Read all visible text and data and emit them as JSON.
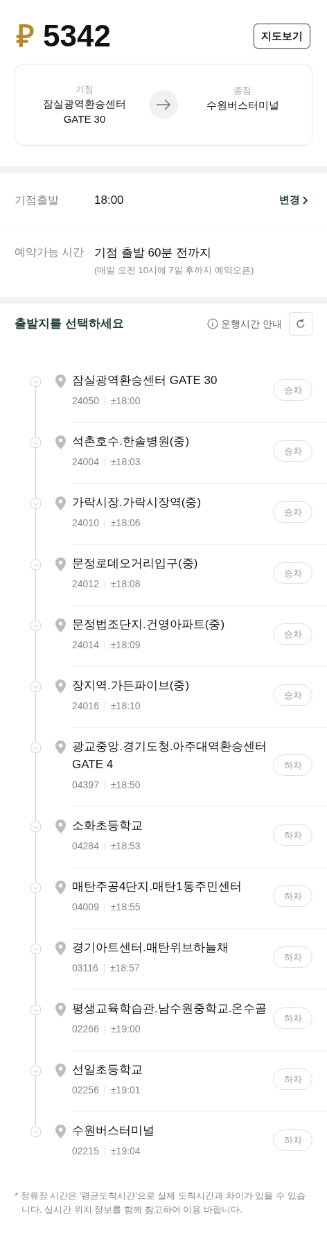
{
  "fare": {
    "symbol": "₽",
    "amount": "5342"
  },
  "map_button": "지도보기",
  "route": {
    "origin_label": "기점",
    "origin": "잠실광역환승센터\nGATE 30",
    "destination_label": "종점",
    "destination": "수원버스터미널"
  },
  "departure": {
    "label": "기점출발",
    "value": "18:00",
    "action": "변경"
  },
  "booking": {
    "label": "예약가능 시간",
    "value": "기점 출발 60분 전까지",
    "note": "(매일 오전 10시에 7일 후까지 예약오픈)"
  },
  "stops_header": {
    "title": "출발지를 선택하세요",
    "info": "운행시간 안내"
  },
  "stops": [
    {
      "name": "잠실광역환승센터 GATE 30",
      "code": "24050",
      "time": "±18:00",
      "action": "승차",
      "disabled": true
    },
    {
      "name": "석촌호수.한솔병원(중)",
      "code": "24004",
      "time": "±18:03",
      "action": "승차",
      "disabled": true
    },
    {
      "name": "가락시장.가락시장역(중)",
      "code": "24010",
      "time": "±18:06",
      "action": "승차",
      "disabled": true
    },
    {
      "name": "문정로데오거리입구(중)",
      "code": "24012",
      "time": "±18:08",
      "action": "승차",
      "disabled": true
    },
    {
      "name": "문정법조단지.건영아파트(중)",
      "code": "24014",
      "time": "±18:09",
      "action": "승차",
      "disabled": true
    },
    {
      "name": "장지역.가든파이브(중)",
      "code": "24016",
      "time": "±18:10",
      "action": "승차",
      "disabled": true
    },
    {
      "name": "광교중앙.경기도청.아주대역환승센터\nGATE 4",
      "code": "04397",
      "time": "±18:50",
      "action": "하차",
      "disabled": true
    },
    {
      "name": "소화초등학교",
      "code": "04284",
      "time": "±18:53",
      "action": "하차",
      "disabled": true
    },
    {
      "name": "매탄주공4단지.매탄1동주민센터",
      "code": "04009",
      "time": "±18:55",
      "action": "하차",
      "disabled": true
    },
    {
      "name": "경기아트센터.매탄위브하늘채",
      "code": "03116",
      "time": "±18:57",
      "action": "하차",
      "disabled": true
    },
    {
      "name": "평생교육학습관.남수원중학교.온수골",
      "code": "02266",
      "time": "±19:00",
      "action": "하차",
      "disabled": true
    },
    {
      "name": "선일초등학교",
      "code": "02256",
      "time": "±19:01",
      "action": "하차",
      "disabled": true
    },
    {
      "name": "수원버스터미널",
      "code": "02215",
      "time": "±19:04",
      "action": "하차",
      "disabled": true
    }
  ],
  "footnote": "* 정류장 시간은 '평균도착시간'으로 실제 도착시간과 차이가 있을 수 있습니다. 실시간 위치 정보를 함께 참고하여 이용 바랍니다."
}
